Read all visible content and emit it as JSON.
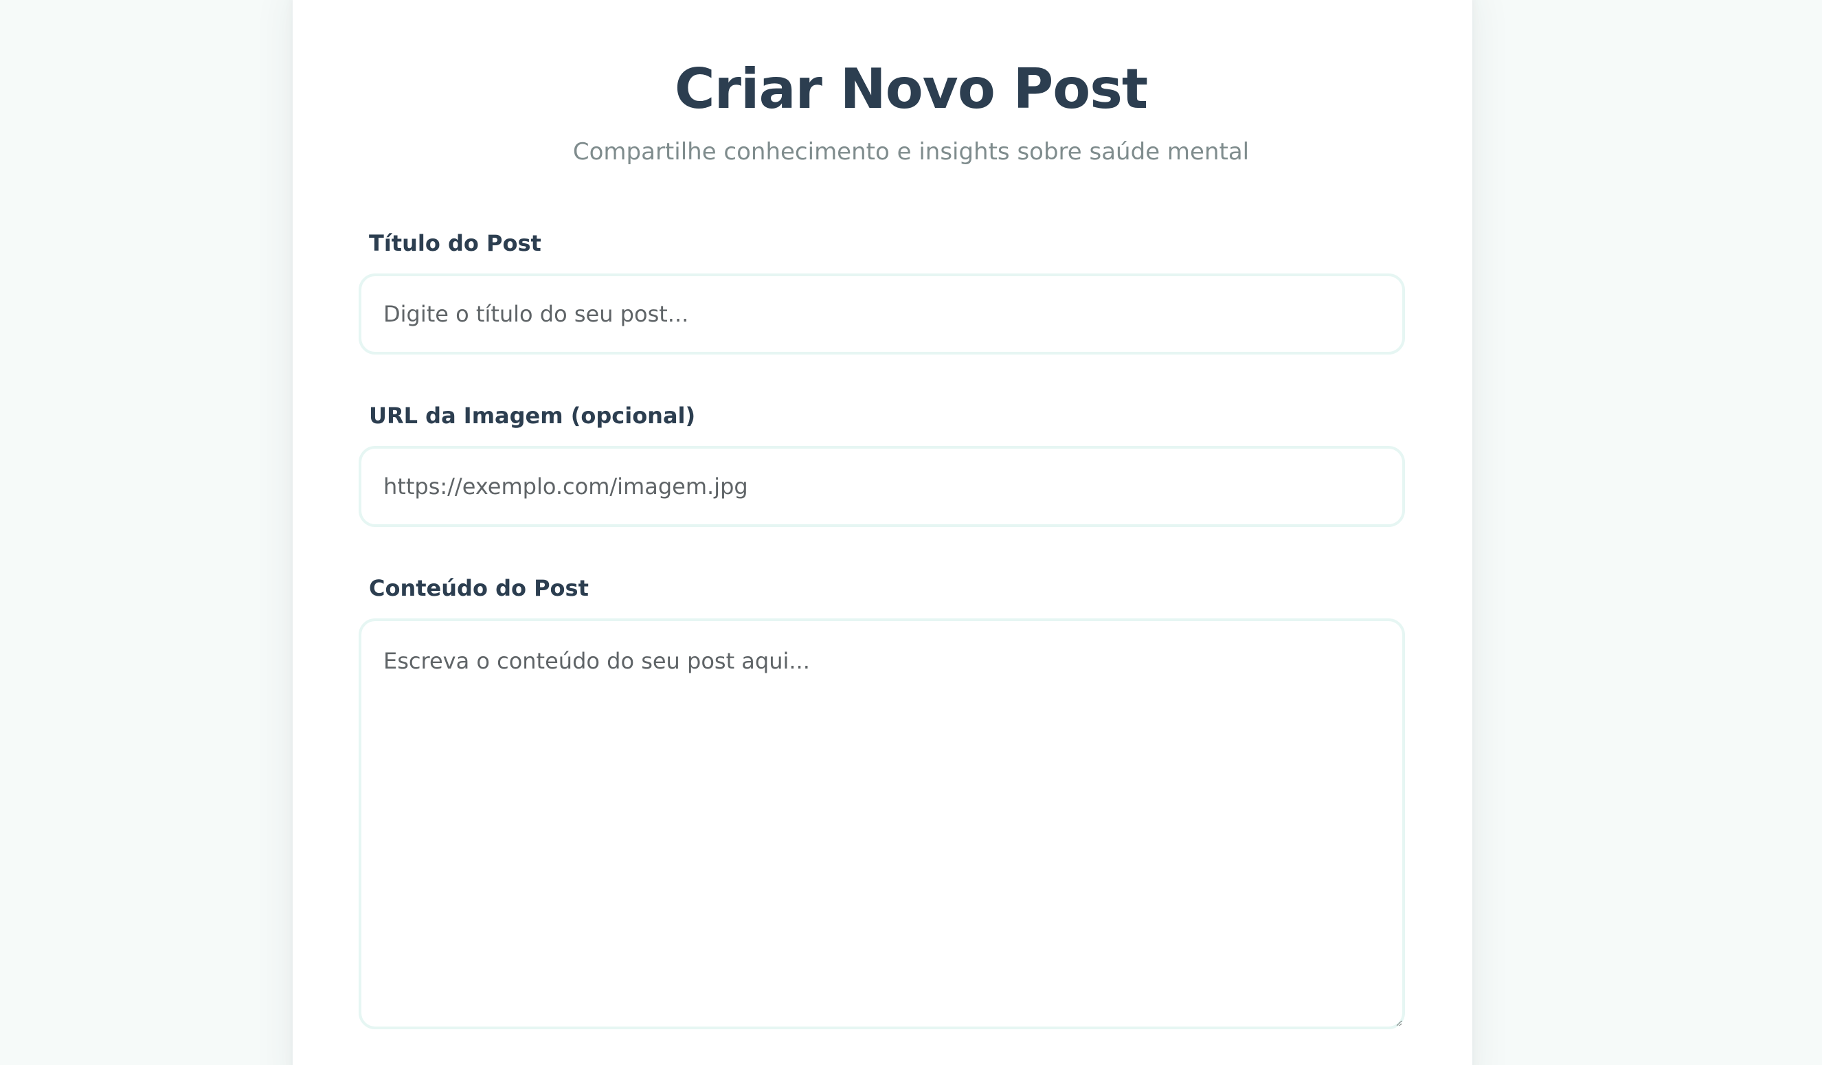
{
  "header": {
    "title": "Criar Novo Post",
    "subtitle": "Compartilhe conhecimento e insights sobre saúde mental"
  },
  "form": {
    "title_field": {
      "label": "Título do Post",
      "placeholder": "Digite o título do seu post...",
      "value": ""
    },
    "image_field": {
      "label": "URL da Imagem (opcional)",
      "placeholder": "https://exemplo.com/imagem.jpg",
      "value": ""
    },
    "content_field": {
      "label": "Conteúdo do Post",
      "placeholder": "Escreva o conteúdo do seu post aqui...",
      "value": ""
    }
  },
  "colors": {
    "background": "#f6faf9",
    "card": "#ffffff",
    "heading": "#2c3e50",
    "subtitle": "#7f8c8d",
    "input_border": "#e6f6f3"
  }
}
